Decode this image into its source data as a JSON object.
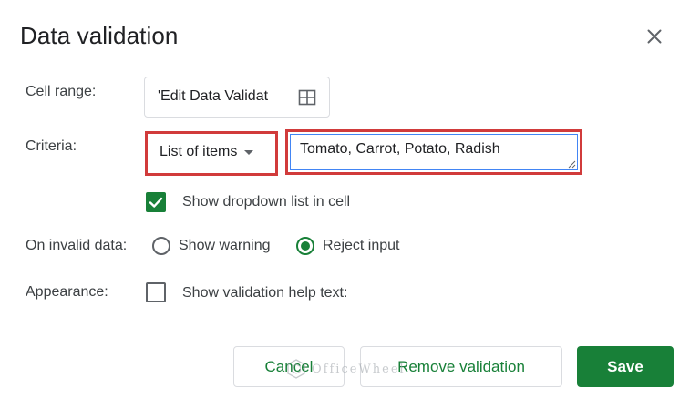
{
  "dialog": {
    "title": "Data validation",
    "close_icon": "close-icon"
  },
  "cell_range": {
    "label": "Cell range:",
    "value": "'Edit Data Validat",
    "icon": "grid-icon"
  },
  "criteria": {
    "label": "Criteria:",
    "selected": "List of items",
    "items_value": "Tomato, Carrot, Potato, Radish",
    "show_dropdown_label": "Show dropdown list in cell",
    "show_dropdown_checked": true
  },
  "invalid_data": {
    "label": "On invalid data:",
    "options": [
      {
        "label": "Show warning",
        "selected": false
      },
      {
        "label": "Reject input",
        "selected": true
      }
    ]
  },
  "appearance": {
    "label": "Appearance:",
    "help_text_label": "Show validation help text:",
    "help_text_checked": false
  },
  "buttons": {
    "cancel": "Cancel",
    "remove": "Remove validation",
    "save": "Save"
  },
  "watermark": {
    "text": "OfficeWheel"
  },
  "colors": {
    "accent_green": "#188038",
    "highlight_red": "#d13b3b",
    "focus_blue": "#4285f4"
  }
}
